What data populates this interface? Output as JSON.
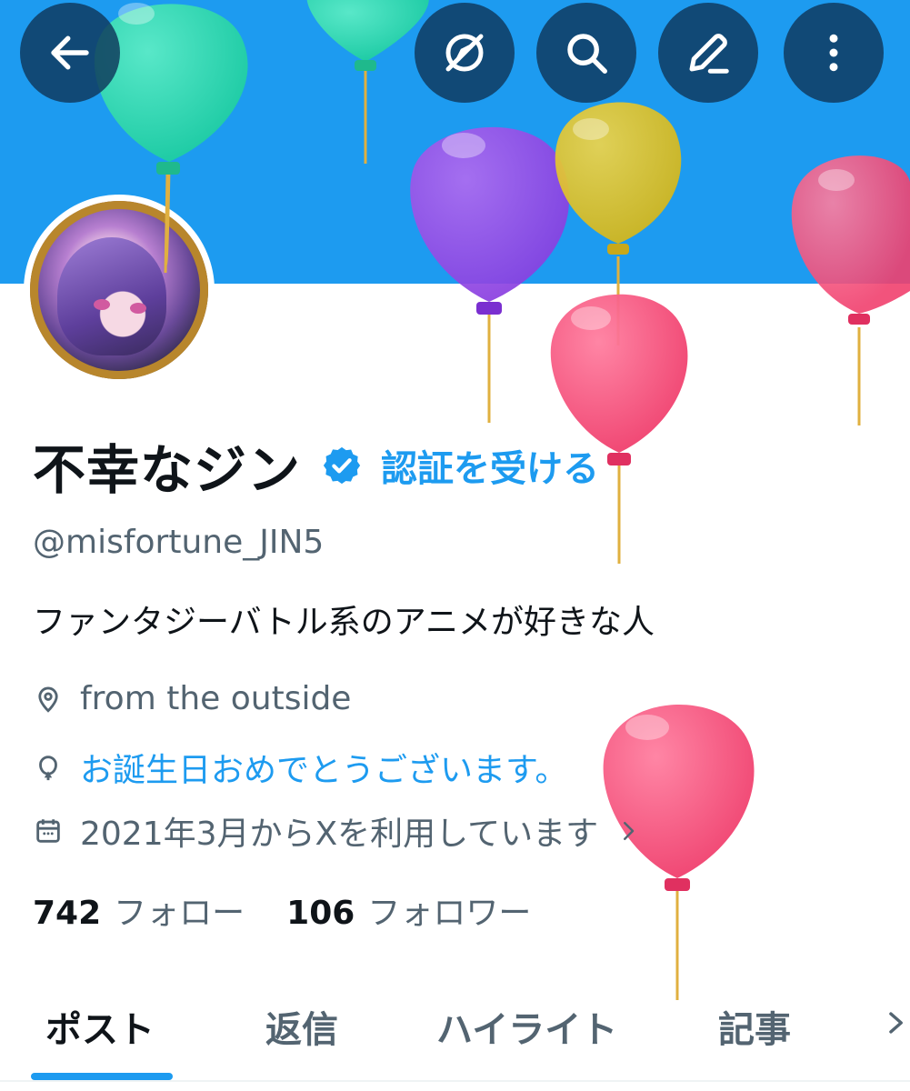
{
  "header": {
    "back_icon": "arrow-left-icon",
    "actions": [
      "explore-off-icon",
      "search-icon",
      "edit-icon",
      "more-vertical-icon"
    ],
    "banner_color": "#1d9bf0"
  },
  "profile": {
    "display_name": "不幸なジン",
    "verify_link": "認証を受ける",
    "handle": "@misfortune_JIN5",
    "bio": "ファンタジーバトル系のアニメが好きな人",
    "location": "from the outside",
    "birthday": "お誕生日おめでとうございます。",
    "joined": "2021年3月からXを利用しています",
    "following_count": "742",
    "following_label": "フォロー",
    "followers_count": "106",
    "followers_label": "フォロワー"
  },
  "tabs": [
    {
      "label": "ポスト",
      "active": true
    },
    {
      "label": "返信",
      "active": false
    },
    {
      "label": "ハイライト",
      "active": false
    },
    {
      "label": "記事",
      "active": false
    }
  ],
  "colors": {
    "accent": "#1d9bf0",
    "text_primary": "#0f1419",
    "text_secondary": "#536471"
  }
}
